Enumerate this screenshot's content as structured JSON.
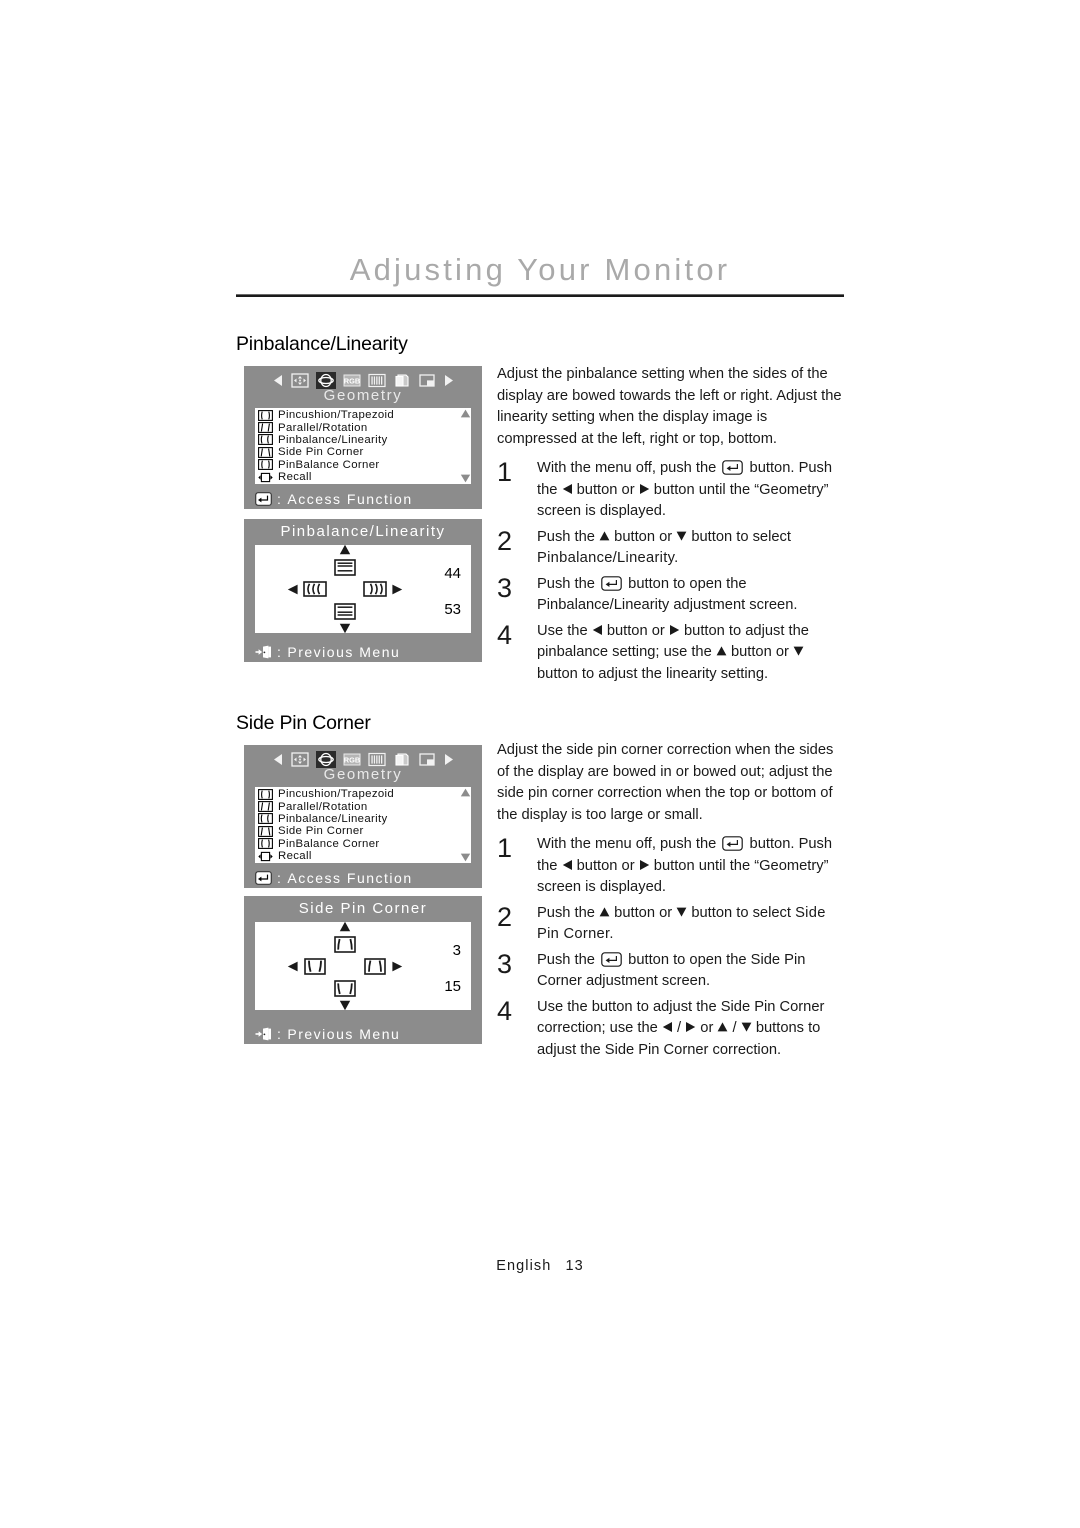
{
  "header": {
    "title": "Adjusting Your Monitor"
  },
  "sections": [
    {
      "heading": "Pinbalance/Linearity",
      "intro": "Adjust the pinbalance setting when the sides of the display are bowed towards the left or right. Adjust the linearity setting when the display image is compressed at the left, right or top, bottom.",
      "steps": [
        {
          "num": "1",
          "line1_a": "With the menu off, push the",
          "line1_b": "button.",
          "line2_a": "Push the",
          "line2_b": "button or",
          "line2_c": "button until the",
          "line3": "“Geometry” screen is displayed."
        },
        {
          "num": "2",
          "line1_a": "Push the",
          "line1_b": "button or",
          "line1_c": "button to select",
          "line2": "Pinbalance/Linearity."
        },
        {
          "num": "3",
          "line1_a": "Push the",
          "line1_b": "button to open the",
          "line2": "Pinbalance/Linearity adjustment screen."
        },
        {
          "num": "4",
          "line1_a": "Use the",
          "line1_b": "button or",
          "line1_c": "button to adjust the",
          "line2_a": "pinbalance setting; use the",
          "line2_b": "button or",
          "line3_b": "button to adjust the linearity setting."
        }
      ]
    },
    {
      "heading": "Side Pin Corner",
      "intro": "Adjust the side pin corner correction when the sides of the display are bowed in or bowed out; adjust the side pin corner correction when the top or bottom of the display is too large or small.",
      "steps": [
        {
          "num": "1",
          "line1_a": "With the menu off, push the",
          "line1_b": "button.",
          "line2_a": "Push the",
          "line2_b": "button or",
          "line2_c": "button until the",
          "line3": "“Geometry” screen is displayed."
        },
        {
          "num": "2",
          "line1_a": "Push the",
          "line1_b": "button or",
          "line1_c": "button to select",
          "line2": "Side Pin Corner."
        },
        {
          "num": "3",
          "line1_a": "Push the",
          "line1_b": "button to open the Side Pin",
          "line2": "Corner adjustment screen."
        },
        {
          "num": "4",
          "line1": "Use the button to adjust the Side Pin Corner",
          "line2_a": "correction; use the",
          "line2_b": "/",
          "line2_c": "or",
          "line2_d": "/",
          "line3_b": "buttons to adjust the Side Pin Corner",
          "line4": "correction."
        }
      ]
    }
  ],
  "osd": {
    "geometry_menu": {
      "category_title": "Geometry",
      "iconbar": [
        "left-arrow-icon",
        "position-icon",
        "geometry-icon",
        "rgb-icon",
        "moire-icon",
        "osd-icon",
        "information-icon",
        "right-arrow-icon"
      ],
      "selected_icon_index": 2,
      "items": [
        {
          "icon": "pincushion-trapezoid-icon",
          "label": "Pincushion/Trapezoid"
        },
        {
          "icon": "parallel-rotation-icon",
          "label": "Parallel/Rotation"
        },
        {
          "icon": "pinbalance-linearity-icon",
          "label": "Pinbalance/Linearity"
        },
        {
          "icon": "side-pin-corner-icon",
          "label": "Side Pin Corner"
        },
        {
          "icon": "pinbalance-corner-icon",
          "label": "PinBalance Corner"
        },
        {
          "icon": "recall-icon",
          "label": "Recall"
        }
      ],
      "footer_label": "Access Function",
      "footer_icon": "enter-key-icon"
    },
    "pinbalance_adjust": {
      "title": "Pinbalance/Linearity",
      "value_top": "44",
      "value_bottom": "53",
      "footer_label": "Previous Menu",
      "footer_icon": "exit-door-icon"
    },
    "sidepin_adjust": {
      "title": "Side Pin Corner",
      "value_top": "3",
      "value_bottom": "15",
      "footer_label": "Previous Menu",
      "footer_icon": "exit-door-icon"
    }
  },
  "footer": {
    "language": "English",
    "page_number": "13"
  },
  "colors": {
    "osd_background": "#8c8c8c",
    "osd_panel": "#ffffff",
    "header_title": "#a9a9a9",
    "rule": "#1a1a1a",
    "body_text": "#1a1a1a"
  }
}
